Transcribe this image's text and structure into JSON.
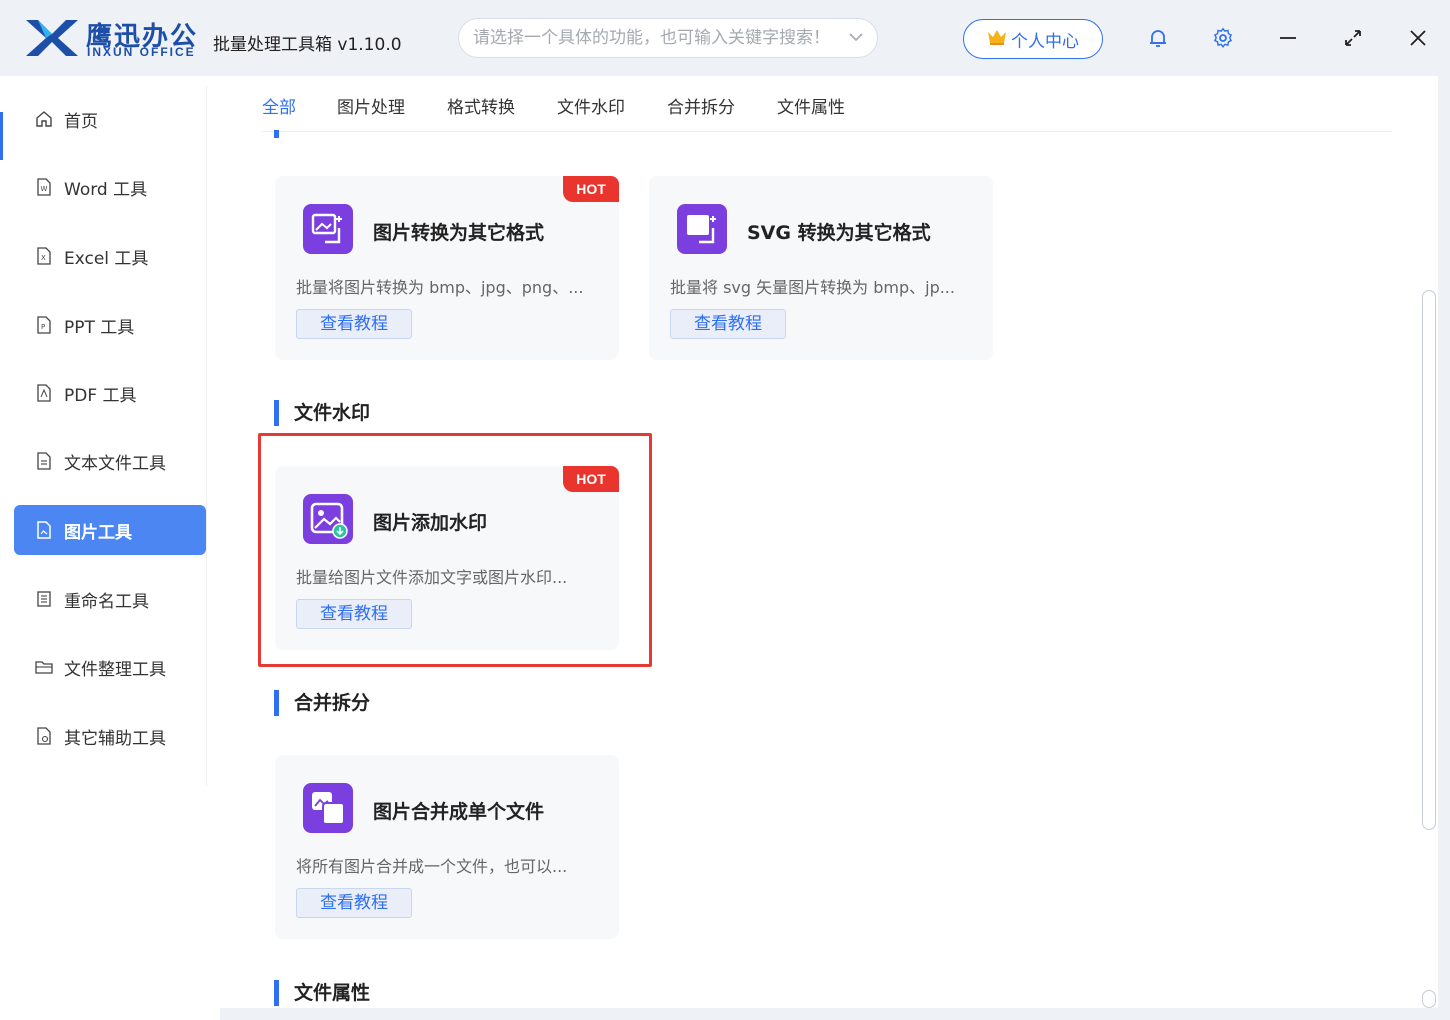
{
  "app": {
    "brand_cn": "鹰迅办公",
    "brand_en": "INXUN OFFICE",
    "title": "批量处理工具箱 v1.10.0"
  },
  "search": {
    "placeholder": "请选择一个具体的功能，也可输入关键字搜索！"
  },
  "header": {
    "user_center_label": "个人中心",
    "icons": [
      "bell-icon",
      "gear-icon",
      "minimize-icon",
      "maximize-icon",
      "close-icon"
    ]
  },
  "sidebar": {
    "items": [
      {
        "label": "首页",
        "icon": "home-icon"
      },
      {
        "label": "Word 工具",
        "icon": "word-file-icon"
      },
      {
        "label": "Excel 工具",
        "icon": "excel-file-icon"
      },
      {
        "label": "PPT 工具",
        "icon": "ppt-file-icon"
      },
      {
        "label": "PDF 工具",
        "icon": "pdf-file-icon"
      },
      {
        "label": "文本文件工具",
        "icon": "text-file-icon"
      },
      {
        "label": "图片工具",
        "icon": "image-file-icon",
        "active": true
      },
      {
        "label": "重命名工具",
        "icon": "rename-icon"
      },
      {
        "label": "文件整理工具",
        "icon": "folder-icon"
      },
      {
        "label": "其它辅助工具",
        "icon": "tools-icon"
      }
    ]
  },
  "tabs": [
    {
      "label": "全部",
      "active": true
    },
    {
      "label": "图片处理"
    },
    {
      "label": "格式转换"
    },
    {
      "label": "文件水印"
    },
    {
      "label": "合并拆分"
    },
    {
      "label": "文件属性"
    }
  ],
  "sections": {
    "watermark": "文件水印",
    "merge_split": "合并拆分",
    "file_props": "文件属性"
  },
  "cards": {
    "img_convert": {
      "title": "图片转换为其它格式",
      "desc": "批量将图片转换为 bmp、jpg、png、...",
      "button": "查看教程",
      "badge": "HOT"
    },
    "svg_convert": {
      "title": "SVG 转换为其它格式",
      "desc": "批量将 svg 矢量图片转换为 bmp、jp...",
      "button": "查看教程"
    },
    "img_watermark": {
      "title": "图片添加水印",
      "desc": "批量给图片文件添加文字或图片水印...",
      "button": "查看教程",
      "badge": "HOT"
    },
    "img_merge": {
      "title": "图片合并成单个文件",
      "desc": "将所有图片合并成一个文件，也可以...",
      "button": "查看教程"
    }
  },
  "colors": {
    "accent": "#2f6ff2",
    "sidebar_active": "#4c86f2",
    "hot_badge": "#e9352e",
    "highlight_box": "#e53a33",
    "card_icon": "#7b3fe0"
  }
}
